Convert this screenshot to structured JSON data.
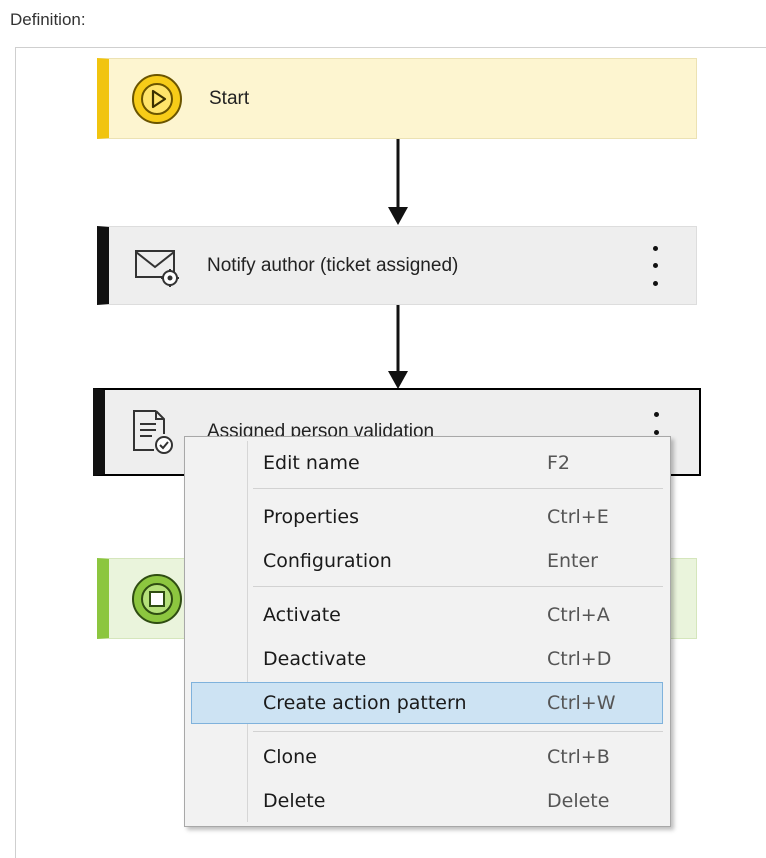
{
  "section": {
    "label": "Definition:"
  },
  "nodes": {
    "start": {
      "label": "Start"
    },
    "notify": {
      "label": "Notify author (ticket assigned)"
    },
    "validation": {
      "label": "Assigned person validation"
    },
    "end": {
      "label": ""
    }
  },
  "colors": {
    "start": "#f1c40f",
    "end": "#8cc63f",
    "highlight": "#cde3f3"
  },
  "context_menu": {
    "items": [
      {
        "label": "Edit name",
        "shortcut": "F2"
      },
      {
        "label": "Properties",
        "shortcut": "Ctrl+E"
      },
      {
        "label": "Configuration",
        "shortcut": "Enter"
      },
      {
        "label": "Activate",
        "shortcut": "Ctrl+A"
      },
      {
        "label": "Deactivate",
        "shortcut": "Ctrl+D"
      },
      {
        "label": "Create action pattern",
        "shortcut": "Ctrl+W",
        "highlighted": true
      },
      {
        "label": "Clone",
        "shortcut": "Ctrl+B"
      },
      {
        "label": "Delete",
        "shortcut": "Delete"
      }
    ]
  }
}
